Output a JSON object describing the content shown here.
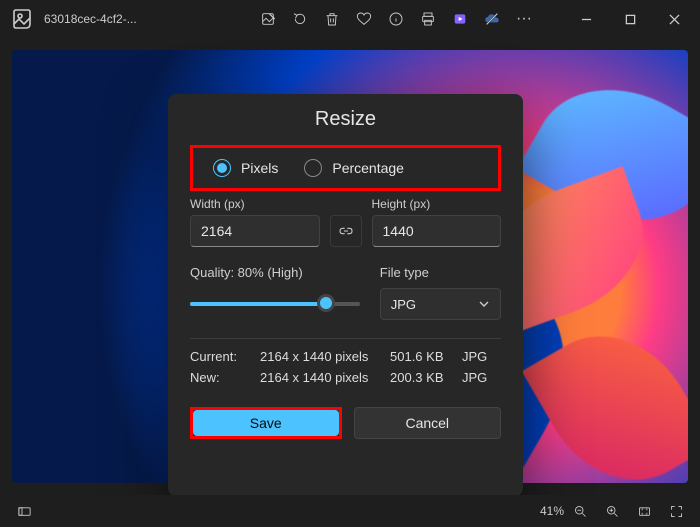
{
  "titlebar": {
    "filename": "63018cec-4cf2-..."
  },
  "dialog": {
    "title": "Resize",
    "modePixels": "Pixels",
    "modePercentage": "Percentage",
    "widthLabel": "Width (px)",
    "heightLabel": "Height (px)",
    "widthValue": "2164",
    "heightValue": "1440",
    "qualityLabel": "Quality: 80% (High)",
    "qualityPercent": 80,
    "fileTypeLabel": "File type",
    "fileTypeValue": "JPG",
    "currentLabel": "Current:",
    "newLabel": "New:",
    "currentDims": "2164 x 1440 pixels",
    "currentSize": "501.6 KB",
    "currentFmt": "JPG",
    "newDims": "2164 x 1440 pixels",
    "newSize": "200.3 KB",
    "newFmt": "JPG",
    "saveLabel": "Save",
    "cancelLabel": "Cancel"
  },
  "statusbar": {
    "zoom": "41%"
  },
  "highlights": {
    "radioGroup": true,
    "saveButton": true
  }
}
